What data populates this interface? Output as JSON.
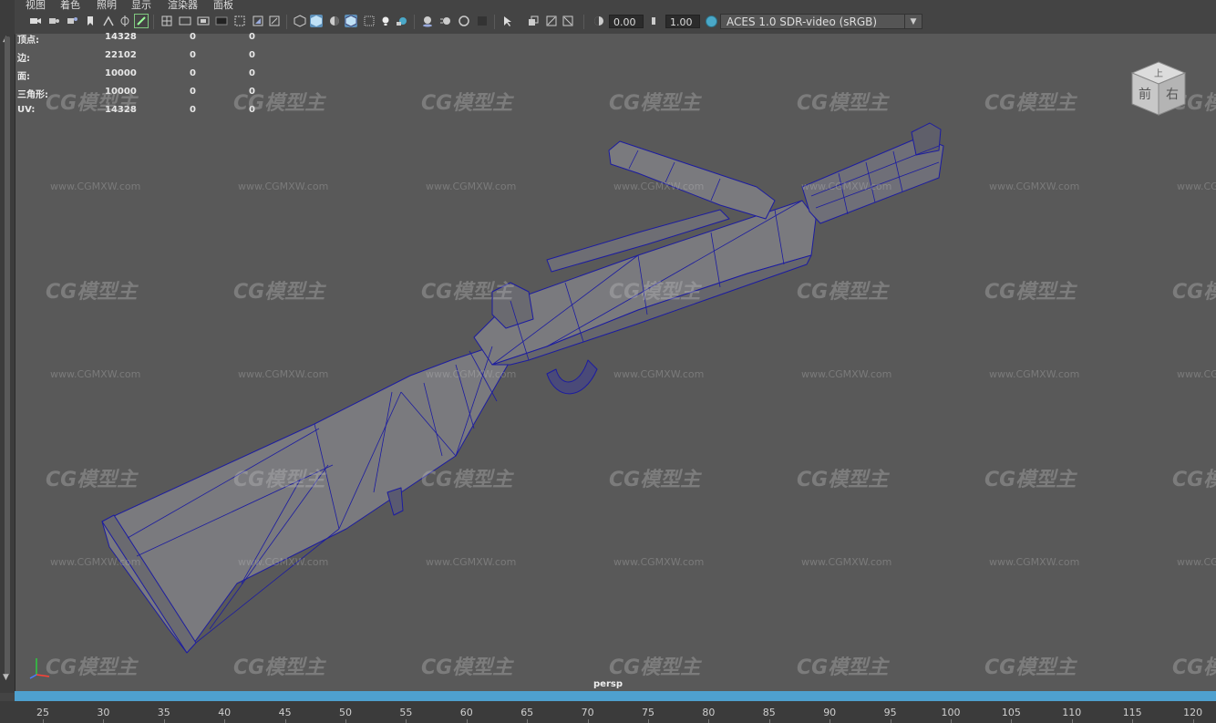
{
  "menu": {
    "items": [
      "视图",
      "着色",
      "照明",
      "显示",
      "渲染器",
      "面板"
    ]
  },
  "toolbar": {
    "field_a": "0.00",
    "field_b": "1.00",
    "color_space": "ACES 1.0 SDR-video (sRGB)",
    "icons": [
      "camera-icon",
      "camera-attr-icon",
      "bookmark-icon",
      "image-plane-icon",
      "grid-icon",
      "film-gate-icon",
      "resolution-gate-icon",
      "gate-mask-icon",
      "field-chart-icon",
      "safe-action-icon",
      "safe-title-icon",
      "wireframe-icon",
      "smooth-shade-icon",
      "default-material-icon",
      "wireframe-on-shaded-icon",
      "xray-icon",
      "use-lights-icon",
      "shadows-icon",
      "ambient-occlusion-icon",
      "motion-blur-icon",
      "anti-alias-icon",
      "depth-of-field-icon",
      "isolate-select-icon",
      "xray-joints-icon",
      "camera-sequencer-icon",
      "exposure-icon",
      "gamma-icon"
    ]
  },
  "hud": {
    "rows": [
      {
        "label": "顶点:",
        "values": [
          "14328",
          "0",
          "0"
        ]
      },
      {
        "label": "边:",
        "values": [
          "22102",
          "0",
          "0"
        ]
      },
      {
        "label": "面:",
        "values": [
          "10000",
          "0",
          "0"
        ]
      },
      {
        "label": "三角形:",
        "values": [
          "10000",
          "0",
          "0"
        ]
      },
      {
        "label": "UV:",
        "values": [
          "14328",
          "0",
          "0"
        ]
      }
    ]
  },
  "viewcube": {
    "top_label": "上",
    "front_label": "前",
    "right_label": "右"
  },
  "viewport": {
    "camera": "persp",
    "bg_color": "#595959",
    "wire_color": "#1a1a9a"
  },
  "watermark": {
    "logo": "CG模型主",
    "url": "www.CGMXW.com"
  },
  "timeline": {
    "ticks": [
      "25",
      "30",
      "35",
      "40",
      "45",
      "50",
      "55",
      "60",
      "65",
      "70",
      "75",
      "80",
      "85",
      "90",
      "95",
      "100",
      "105",
      "110",
      "115",
      "120"
    ],
    "bar_color": "#4ea0cf"
  }
}
